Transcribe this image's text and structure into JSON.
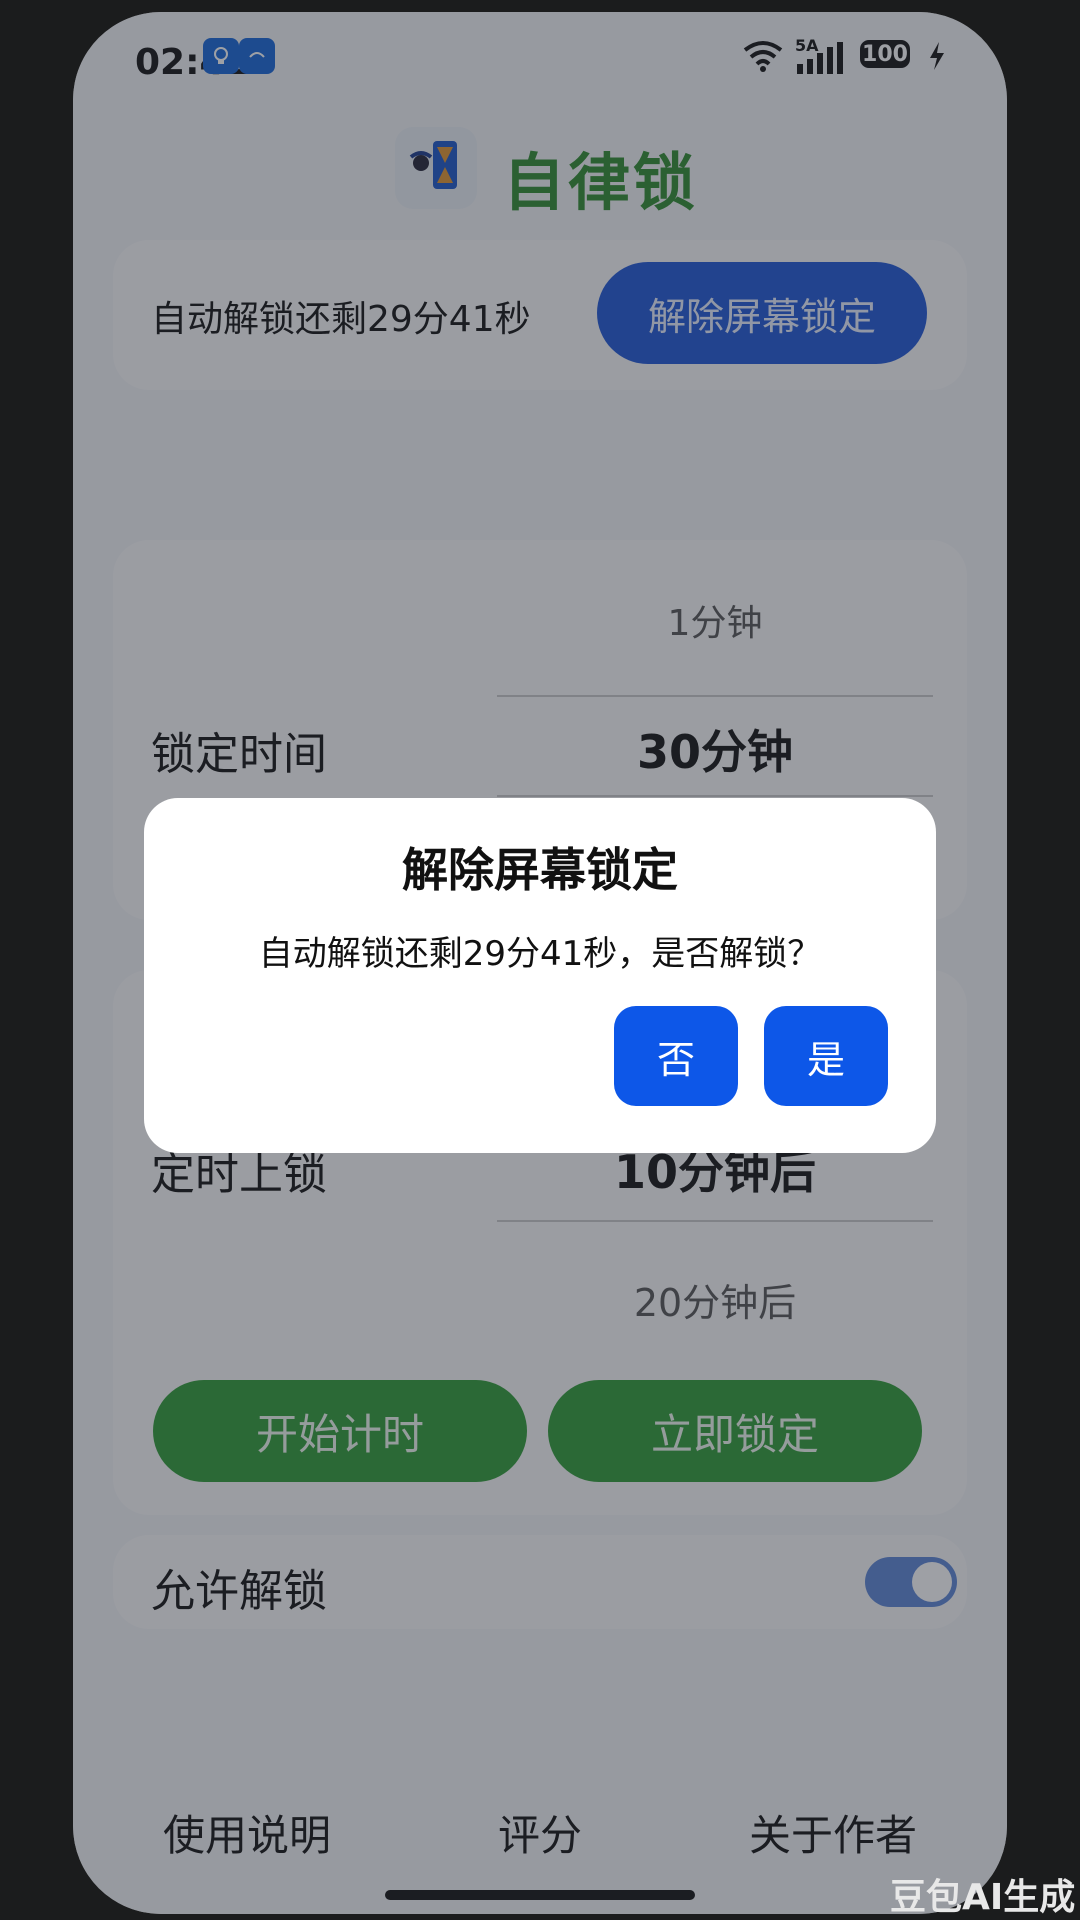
{
  "status_bar": {
    "time": "02:42",
    "network": "5A",
    "battery": "100"
  },
  "app": {
    "title": "自律锁",
    "title_color": "#2e8b2e"
  },
  "status_card": {
    "countdown_text": "自动解锁还剩29分41秒",
    "unlock_button": "解除屏幕锁定"
  },
  "lock_time": {
    "label": "锁定时间",
    "options_above": "1分钟",
    "selected": "30分钟"
  },
  "scheduled_lock": {
    "label": "定时上锁",
    "selected": "10分钟后",
    "options_below": "20分钟后"
  },
  "actions": {
    "start_timer": "开始计时",
    "lock_now": "立即锁定"
  },
  "allow_unlock": {
    "label": "允许解锁",
    "enabled": true
  },
  "bottom_nav": {
    "instructions": "使用说明",
    "rate": "评分",
    "about": "关于作者"
  },
  "dialog": {
    "title": "解除屏幕锁定",
    "message": "自动解锁还剩29分41秒，是否解锁？",
    "no": "否",
    "yes": "是"
  },
  "watermark": "豆包AI生成",
  "colors": {
    "primary_blue": "#0d57e8",
    "green_button": "#2f9b35"
  }
}
